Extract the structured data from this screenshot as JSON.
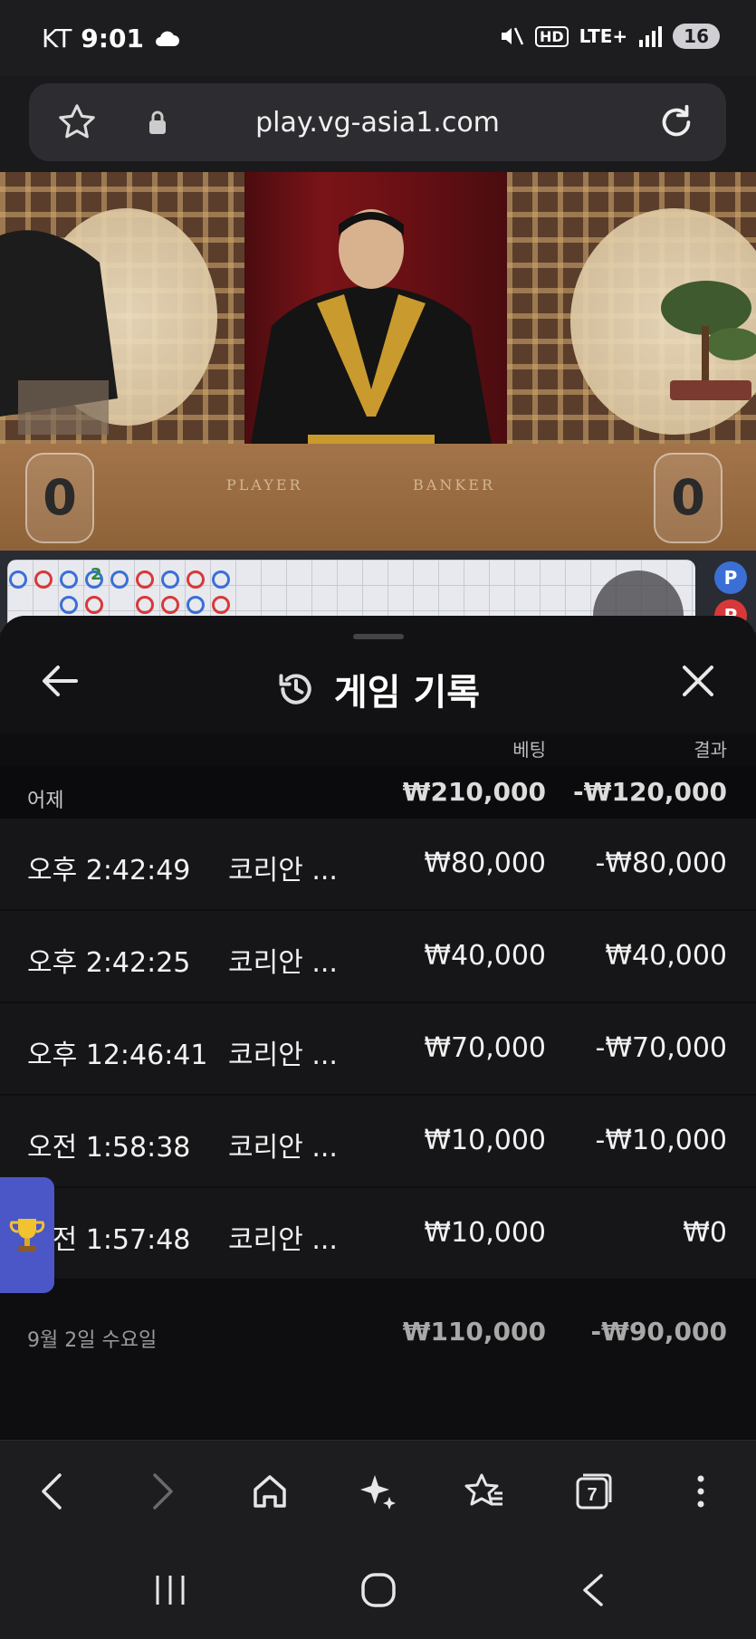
{
  "status_bar": {
    "carrier": "KT",
    "time": "9:01",
    "hd": "HD",
    "network": "LTE+",
    "battery": "16"
  },
  "browser": {
    "url": "play.vg-asia1.com"
  },
  "video": {
    "player_label": "PLAYER",
    "banker_label": "BANKER",
    "player_score": "0",
    "banker_score": "0",
    "road_number": "2",
    "side_badge_1": "P",
    "side_badge_2": "P"
  },
  "history": {
    "title": "게임 기록",
    "column_bet": "베팅",
    "column_result": "결과",
    "groups": [
      {
        "label": "어제",
        "bet_total": "₩210,000",
        "result_total": "-₩120,000",
        "rows": [
          {
            "time": "오후 2:42:49",
            "game": "코리안 ...",
            "bet": "₩80,000",
            "result": "-₩80,000"
          },
          {
            "time": "오후 2:42:25",
            "game": "코리안 ...",
            "bet": "₩40,000",
            "result": "₩40,000"
          },
          {
            "time": "오후 12:46:41",
            "game": "코리안 ...",
            "bet": "₩70,000",
            "result": "-₩70,000"
          },
          {
            "time": "오전 1:58:38",
            "game": "코리안 ...",
            "bet": "₩10,000",
            "result": "-₩10,000"
          },
          {
            "time": "오전 1:57:48",
            "game": "코리안 ...",
            "bet": "₩10,000",
            "result": "₩0"
          }
        ]
      },
      {
        "label": "9월 2일 수요일",
        "bet_total": "₩110,000",
        "result_total": "-₩90,000"
      }
    ]
  },
  "colors": {
    "accent_blue": "#4b56c7",
    "player_blue": "#3b6fd6",
    "banker_red": "#d93838"
  }
}
